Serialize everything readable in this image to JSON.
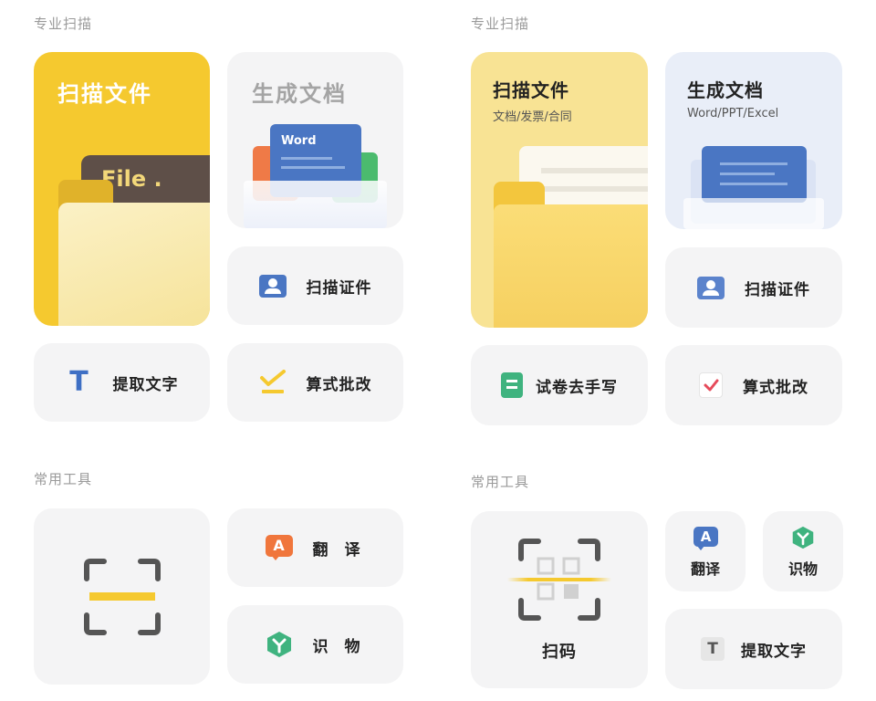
{
  "left": {
    "pro_title": "专业扫描",
    "scan_file": {
      "label": "扫描文件",
      "folder_text": "File ."
    },
    "gen_doc": {
      "label": "生成文档",
      "doc_text": "Word"
    },
    "scan_id": {
      "label": "扫描证件"
    },
    "extract_text": {
      "label": "提取文字",
      "icon_glyph": "T"
    },
    "math_check": {
      "label": "算式批改"
    },
    "tools_title": "常用工具",
    "translate": {
      "label": "翻 译",
      "icon_glyph": "A"
    },
    "identify": {
      "label": "识 物"
    }
  },
  "right": {
    "pro_title": "专业扫描",
    "scan_file": {
      "label": "扫描文件",
      "sub": "文档/发票/合同"
    },
    "gen_doc": {
      "label": "生成文档",
      "sub": "Word/PPT/Excel"
    },
    "scan_id": {
      "label": "扫描证件"
    },
    "exam": {
      "label": "试卷去手写"
    },
    "math_check": {
      "label": "算式批改"
    },
    "tools_title": "常用工具",
    "scan_code": {
      "label": "扫码"
    },
    "translate": {
      "label": "翻译",
      "icon_glyph": "A"
    },
    "identify": {
      "label": "识物"
    },
    "extract_text": {
      "label": "提取文字",
      "icon_glyph": "T"
    }
  },
  "colors": {
    "accent_yellow": "#f5c92f",
    "light_yellow": "#f8e394",
    "card_gray": "#f4f4f5",
    "blue": "#4a76c3",
    "orange": "#f0763c",
    "green": "#3fb37f"
  }
}
